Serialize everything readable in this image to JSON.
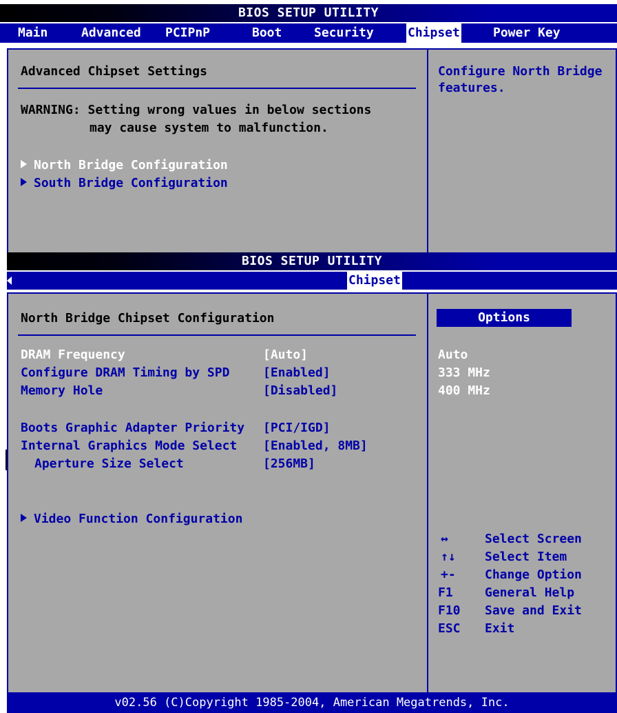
{
  "top_screen": {
    "title": "BIOS SETUP UTILITY",
    "tabs": [
      {
        "label": "Main"
      },
      {
        "label": "Advanced"
      },
      {
        "label": "PCIPnP"
      },
      {
        "label": "Boot"
      },
      {
        "label": "Security"
      },
      {
        "label": "Chipset",
        "active": true
      },
      {
        "label": "Power Key"
      }
    ],
    "heading": "Advanced Chipset Settings",
    "warning_line1": "WARNING: Setting wrong values in below sections",
    "warning_line2": "may cause system to malfunction.",
    "submenus": [
      {
        "label": "North Bridge Configuration"
      },
      {
        "label": "South Bridge Configuration"
      }
    ],
    "help_line1": "Configure North Bridge",
    "help_line2": "features."
  },
  "bottom_screen": {
    "title": "BIOS SETUP UTILITY",
    "active_tab": "Chipset",
    "heading": "North Bridge Chipset Configuration",
    "settings": [
      {
        "label": "DRAM Frequency",
        "value": "[Auto]",
        "selected": true
      },
      {
        "label": "Configure DRAM Timing by SPD",
        "value": "[Enabled]"
      },
      {
        "label": "Memory Hole",
        "value": "[Disabled]"
      },
      {
        "label": "Boots Graphic Adapter Priority",
        "value": "[PCI/IGD]"
      },
      {
        "label": "Internal Graphics Mode Select",
        "value": "[Enabled, 8MB]"
      },
      {
        "label": "Aperture Size Select",
        "value": "[256MB]"
      }
    ],
    "submenu": "Video Function Configuration",
    "options_title": "Options",
    "options": [
      "Auto",
      "333 MHz",
      "400 MHz"
    ],
    "keys": [
      {
        "key": "↔",
        "desc": "Select Screen"
      },
      {
        "key": "↑↓",
        "desc": "Select Item"
      },
      {
        "key": "+-",
        "desc": "Change Option"
      },
      {
        "key": "F1",
        "desc": "General Help"
      },
      {
        "key": "F10",
        "desc": "Save and Exit"
      },
      {
        "key": "ESC",
        "desc": "Exit"
      }
    ]
  },
  "footer": "v02.56 (C)Copyright 1985-2004, American Megatrends, Inc.",
  "colors": {
    "bios_blue": "#0000a8",
    "panel_gray": "#a8a8a8",
    "text_white": "#ffffff"
  }
}
